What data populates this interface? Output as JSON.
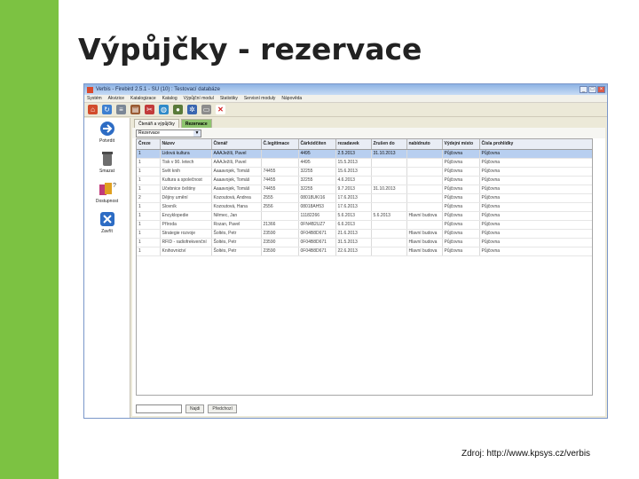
{
  "slide": {
    "title": "Výpůjčky - rezervace",
    "source": "Zdroj: http://www.kpsys.cz/verbis",
    "accent_color": "#7cc242"
  },
  "window": {
    "title": "Verbis - Firebird 2.5.1 - SU (10) : Testovací databáze",
    "buttons": [
      "_",
      "□",
      "×"
    ],
    "menu": [
      "Systém",
      "Akvizice",
      "Katalogizace",
      "Katalog",
      "Výpůjční modul",
      "Statistiky",
      "Servisní moduly",
      "Nápověda"
    ],
    "toolbar_icons": [
      "home-icon",
      "refresh-icon",
      "list-icon",
      "book-icon",
      "scissors-icon",
      "globe-icon",
      "user-icon",
      "settings-icon",
      "print-icon",
      "close-icon"
    ]
  },
  "sidebar": {
    "items": [
      {
        "label": "Potvrdit",
        "icon": "confirm-icon"
      },
      {
        "label": "Smazat",
        "icon": "trash-icon"
      },
      {
        "label": "Dostupnost",
        "icon": "availability-icon"
      },
      {
        "label": "Zavřít",
        "icon": "close-icon"
      }
    ]
  },
  "tabs": [
    {
      "label": "Čtenáři a výpůjčky",
      "active": false
    },
    {
      "label": "Rezervace",
      "active": true
    }
  ],
  "filter": {
    "value": "Rezervace"
  },
  "table": {
    "columns": [
      "Čreze",
      "Název",
      "Čtenář",
      "Č.legitimace",
      "Čárkódčiten",
      "rezadavek",
      "Zrušen do",
      "nabídnuto",
      "Výdejní místo",
      "Čísla prohlídky"
    ],
    "rows": [
      [
        "1",
        "Lidová kultura",
        "AAAJežíš, Pavel",
        "",
        "4495",
        "2.5.2013",
        "31.10.2013",
        "",
        "Půjčovna",
        "Půjčovna"
      ],
      [
        "1",
        "Tisk v 90. letech",
        "AAAJežíš, Pavel",
        "",
        "4495",
        "15.5.2013",
        "",
        "",
        "Půjčovna",
        "Půjčovna"
      ],
      [
        "1",
        "Svět knih",
        "Aaaavojek, Tomáš",
        "74455",
        "32255",
        "15.6.2013",
        "",
        "",
        "Půjčovna",
        "Půjčovna"
      ],
      [
        "1",
        "Kultura a společnost",
        "Aaaavojek, Tomáš",
        "74455",
        "32255",
        "4.6.2013",
        "",
        "",
        "Půjčovna",
        "Půjčovna"
      ],
      [
        "1",
        "Učebnice češtiny",
        "Aaaavojek, Tomáš",
        "74455",
        "32255",
        "9.7.2013",
        "31.10.2013",
        "",
        "Půjčovna",
        "Půjčovna"
      ],
      [
        "2",
        "Dějiny umění",
        "Kozoutová, Andrea",
        "2555",
        "08018UKI16",
        "17.6.2013",
        "",
        "",
        "Půjčovna",
        "Půjčovna"
      ],
      [
        "1",
        "Slovník",
        "Kozoutová, Hana",
        "2556",
        "08018AH53",
        "17.6.2013",
        "",
        "",
        "Půjčovna",
        "Půjčovna"
      ],
      [
        "1",
        "Encyklopedie",
        "Němec, Jan",
        "",
        "11182266",
        "5.6.2013",
        "5.6.2013",
        "Hlavní budova",
        "Půjčovna",
        "Půjčovna"
      ],
      [
        "1",
        "Příroda",
        "Rozan, Pavel",
        "21366",
        "0FN4B2UZ7",
        "6.6.2013",
        "",
        "",
        "Půjčovna",
        "Půjčovna"
      ],
      [
        "1",
        "Strategie rozvoje",
        "Šoltés, Petr",
        "23590",
        "0F04B8D671",
        "21.6.2013",
        "",
        "Hlavní budova",
        "Půjčovna",
        "Půjčovna"
      ],
      [
        "1",
        "RFID - radiofrekvenční",
        "Šoltés, Petr",
        "23590",
        "0F04B8D671",
        "31.5.2013",
        "",
        "Hlavní budova",
        "Půjčovna",
        "Půjčovna"
      ],
      [
        "1",
        "Knihovnictví",
        "Šoltés, Petr",
        "23590",
        "0F04B8D671",
        "22.6.2013",
        "",
        "Hlavní budova",
        "Půjčovna",
        "Půjčovna"
      ]
    ]
  },
  "bottom": {
    "search_value": "",
    "buttons": [
      "Najdi",
      "Předchozí"
    ]
  }
}
